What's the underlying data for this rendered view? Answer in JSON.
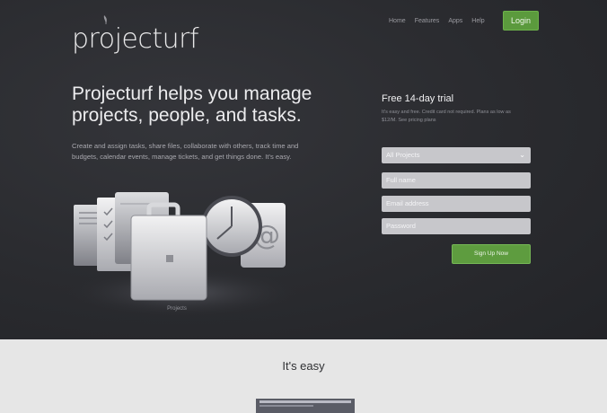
{
  "brand": {
    "logo_text": "projecturf"
  },
  "topnav": {
    "items": [
      "Home",
      "Features",
      "Apps",
      "Help"
    ],
    "login_label": "Login"
  },
  "hero": {
    "headline": "Projecturf helps you manage projects, people, and tasks.",
    "description": "Create and assign tasks, share files, collaborate with others, track time and budgets, calendar events, manage tickets, and get things done. It's easy.",
    "art_caption": "Projects"
  },
  "signup": {
    "title": "Free 14-day trial",
    "subtitle": "It's easy and free. Credit card not required. Plans as low as $12/M. See pricing plans",
    "plan_select": "All Projects",
    "fullname_placeholder": "Full name",
    "email_placeholder": "Email address",
    "password_placeholder": "Password",
    "button_label": "Sign Up Now"
  },
  "section": {
    "title": "It's easy"
  },
  "colors": {
    "hero_bg": "#2b2c30",
    "accent_green": "#5e9c3f",
    "field_bg": "#c7c7cb",
    "page_bg": "#e6e6e6"
  }
}
